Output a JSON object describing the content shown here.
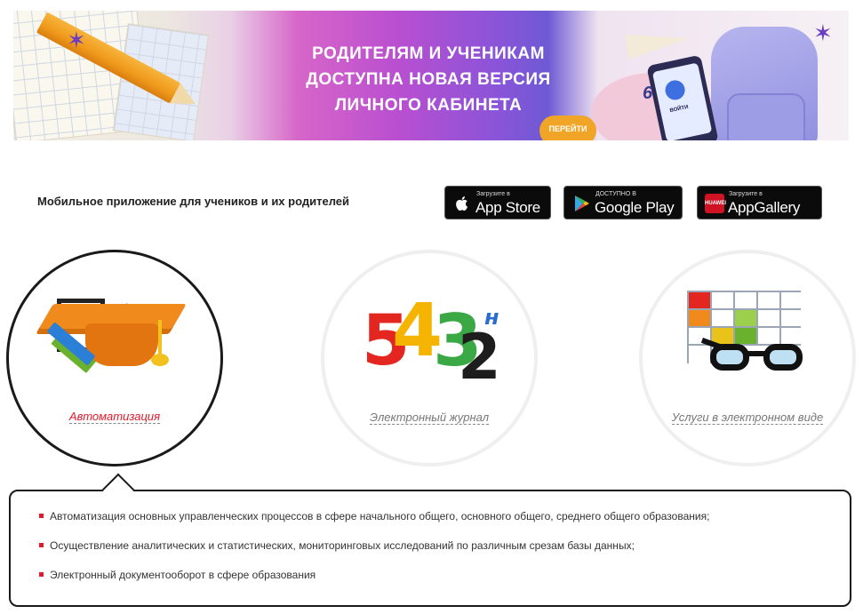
{
  "banner": {
    "headline_line1": "РОДИТЕЛЯМ И УЧЕНИКАМ",
    "headline_line2": "ДОСТУПНА НОВАЯ ВЕРСИЯ",
    "headline_line3": "ЛИЧНОГО КАБИНЕТА",
    "go_label": "ПЕРЕЙТИ",
    "phone_button_label": "ВОЙТИ"
  },
  "apps": {
    "caption": "Мобильное приложение для учеников и их родителей",
    "appstore": {
      "small": "Загрузите в",
      "big": "App Store"
    },
    "google": {
      "small": "ДОСТУПНО В",
      "big": "Google Play"
    },
    "huawei": {
      "small": "Загрузите в",
      "big": "AppGallery"
    }
  },
  "circles": {
    "automation": {
      "label": "Автоматизация"
    },
    "journal": {
      "label": "Электронный журнал"
    },
    "services": {
      "label": "Услуги в электронном виде"
    }
  },
  "info": {
    "items": [
      "Автоматизация основных управленческих процессов в сфере начального общего, основного общего, среднего общего образования;",
      "Осуществление аналитических и статистических, мониторинговых исследований по различным срезам базы данных;",
      "Электронный документооборот в сфере образования"
    ]
  },
  "colors": {
    "accent_red": "#e2192a",
    "store_black": "#0b0b0b"
  }
}
